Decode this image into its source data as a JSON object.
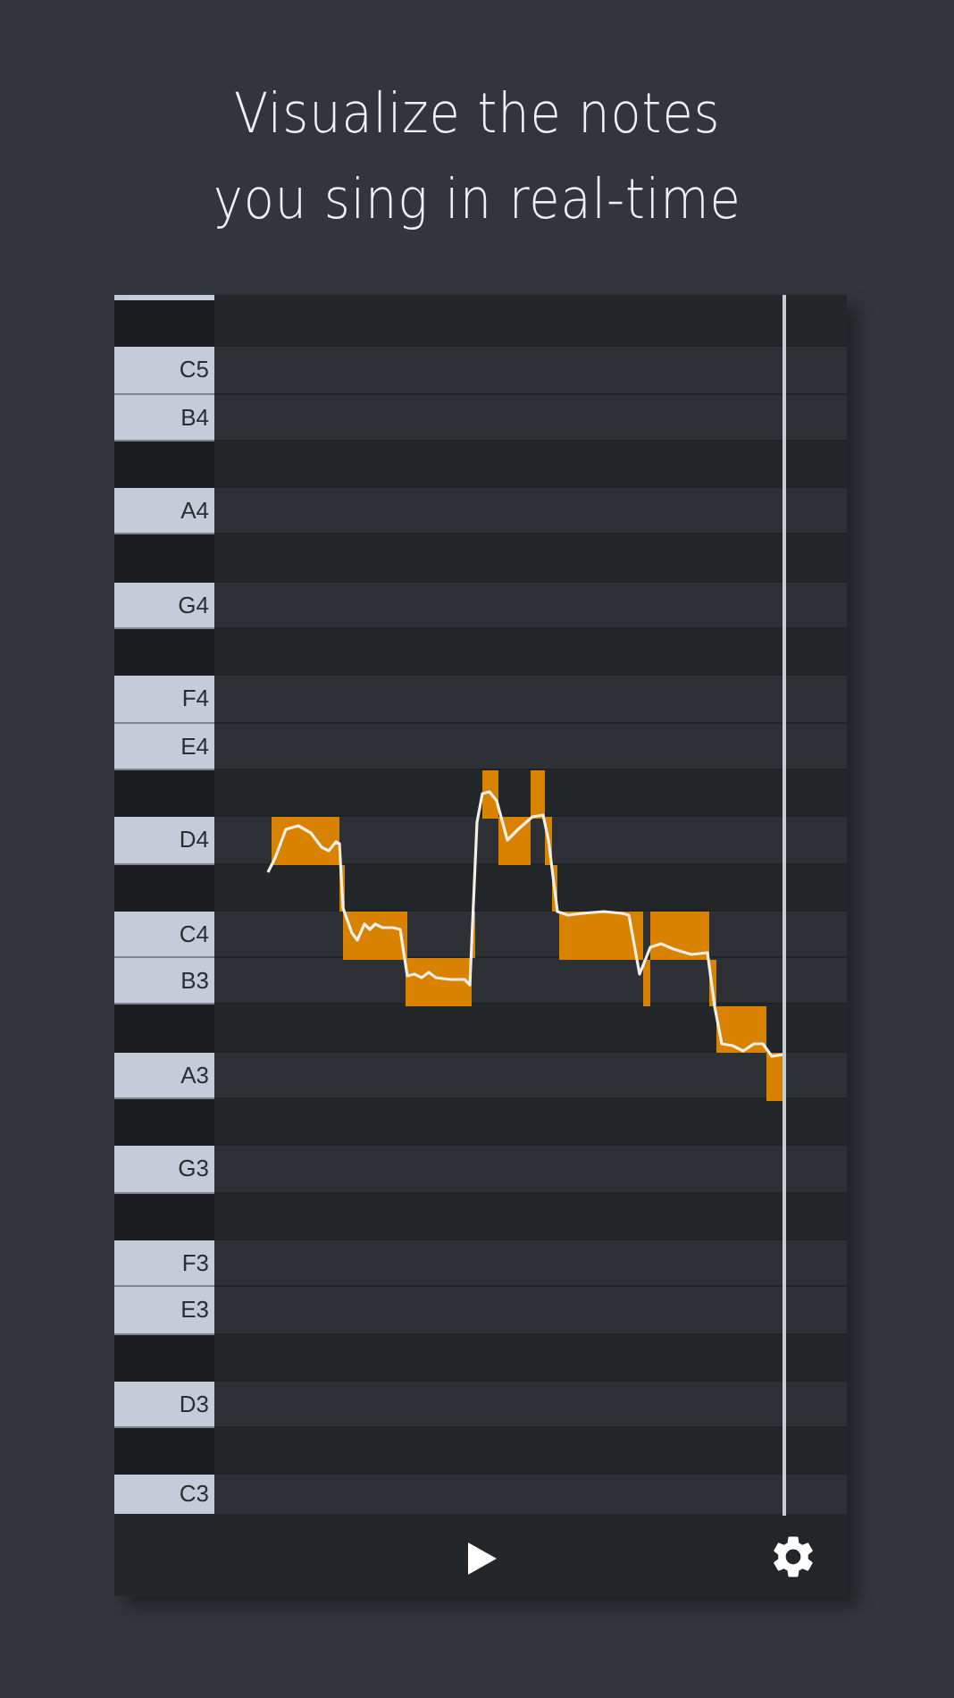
{
  "headline": {
    "lines": [
      "Visualize the notes",
      "you sing in real-time"
    ]
  },
  "keys": [
    {
      "kind": "edge"
    },
    {
      "kind": "black"
    },
    {
      "kind": "white",
      "label": "C5"
    },
    {
      "kind": "white",
      "label": "B4"
    },
    {
      "kind": "black"
    },
    {
      "kind": "white",
      "label": "A4"
    },
    {
      "kind": "black"
    },
    {
      "kind": "white",
      "label": "G4"
    },
    {
      "kind": "black"
    },
    {
      "kind": "white",
      "label": "F4"
    },
    {
      "kind": "white",
      "label": "E4"
    },
    {
      "kind": "black"
    },
    {
      "kind": "white",
      "label": "D4"
    },
    {
      "kind": "black"
    },
    {
      "kind": "white",
      "label": "C4"
    },
    {
      "kind": "white",
      "label": "B3"
    },
    {
      "kind": "black"
    },
    {
      "kind": "white",
      "label": "A3"
    },
    {
      "kind": "black"
    },
    {
      "kind": "white",
      "label": "G3"
    },
    {
      "kind": "black"
    },
    {
      "kind": "white",
      "label": "F3"
    },
    {
      "kind": "white",
      "label": "E3"
    },
    {
      "kind": "black"
    },
    {
      "kind": "white",
      "label": "D3"
    },
    {
      "kind": "black"
    },
    {
      "kind": "cut",
      "label": "C3"
    }
  ]
}
